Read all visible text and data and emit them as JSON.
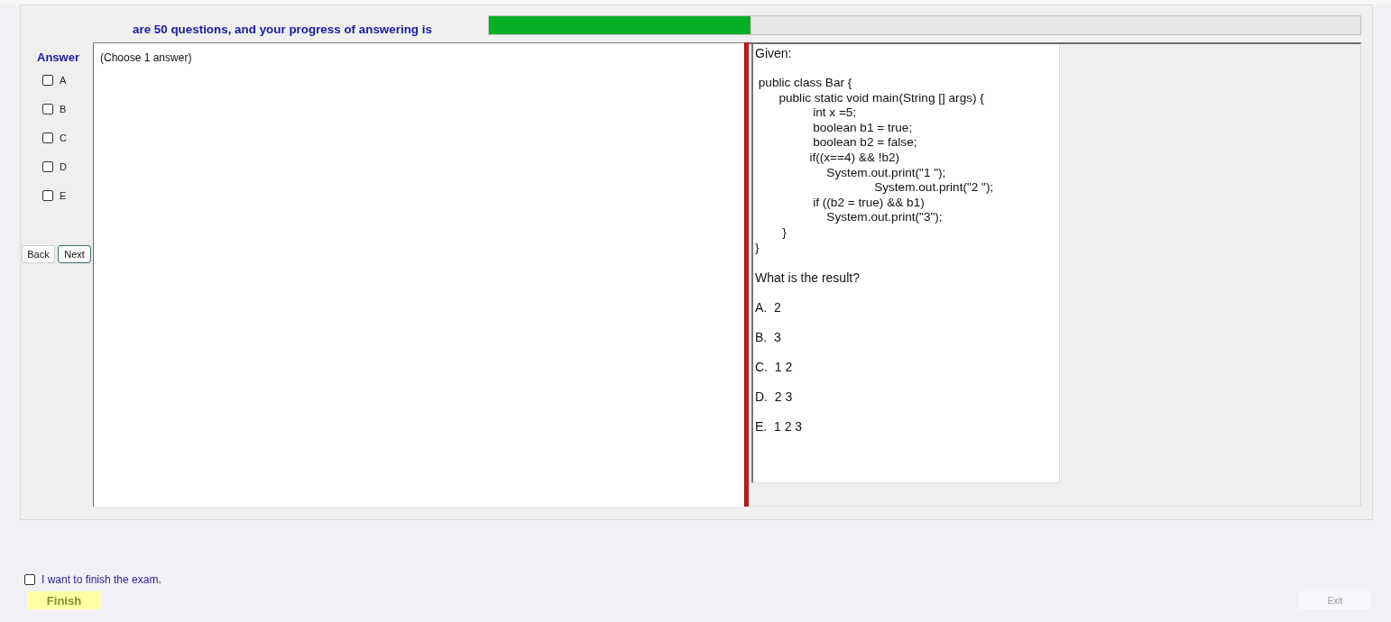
{
  "header": {
    "text": "are 50 questions, and your progress of answering is",
    "progress": {
      "level": 0.3
    }
  },
  "answer_panel": {
    "title": "Answer",
    "options": [
      {
        "label": "A",
        "checked": false
      },
      {
        "label": "B",
        "checked": false
      },
      {
        "label": "C",
        "checked": false
      },
      {
        "label": "D",
        "checked": false
      },
      {
        "label": "E",
        "checked": false
      }
    ],
    "buttons": [
      {
        "label": "Back",
        "focused": false
      },
      {
        "label": "Next",
        "focused": true
      }
    ]
  },
  "question_pane": {
    "instruction": "(Choose 1 answer)"
  },
  "question": {
    "intro": "Given:",
    "code_lines": [
      " public class Bar {",
      "       public static void main(String [] args) {",
      "                 int x =5;",
      "                 boolean b1 = true;",
      "                 boolean b2 = false;",
      "                if((x==4) && !b2)",
      "                     System.out.print(\"1 \");",
      "                                   System.out.print(\"2 \");",
      "                 if ((b2 = true) && b1)",
      "                     System.out.print(\"3\");",
      "        }",
      "}"
    ],
    "prompt": "What is the result?",
    "choices": [
      "A.  2",
      "B.  3",
      "C.  1 2",
      "D.  2 3",
      "E.  1 2 3"
    ]
  },
  "footer": {
    "finish_confirm": {
      "label": "I want to finish the exam.",
      "checked": false
    },
    "buttons": [
      {
        "label": "Finish",
        "kind": "finish",
        "disabled": false
      },
      {
        "label": "Exit",
        "kind": "exit",
        "disabled": true
      }
    ]
  }
}
